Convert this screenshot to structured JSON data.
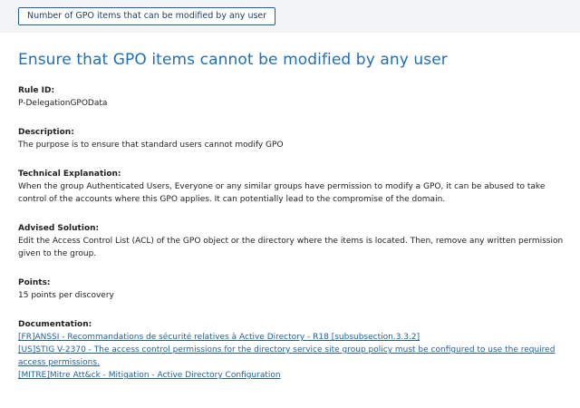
{
  "header": {
    "tag_label": "Number of GPO items that can be modified by any user"
  },
  "page": {
    "title": "Ensure that GPO items cannot be modified by any user"
  },
  "rule_id": {
    "label": "Rule ID:",
    "value": "P-DelegationGPOData"
  },
  "description": {
    "label": "Description:",
    "value": "The purpose is to ensure that standard users cannot modify GPO"
  },
  "technical_explanation": {
    "label": "Technical Explanation:",
    "value": "When the group Authenticated Users, Everyone or any similar groups have permission to modify a GPO, it can be abused to take control of the accounts where this GPO applies. It can potentially lead to the compromise of the domain."
  },
  "advised_solution": {
    "label": "Advised Solution:",
    "value": "Edit the Access Control List (ACL) of the GPO object or the directory where the items is located. Then, remove any written permission given to the group."
  },
  "points": {
    "label": "Points:",
    "value": "15 points per discovery"
  },
  "documentation": {
    "label": "Documentation:",
    "links": [
      "[FR]ANSSI - Recommandations de sécurité relatives à Active Directory - R18 [subsubsection.3.3.2]",
      "[US]STIG V-2370 - The access control permissions for the directory service site group policy must be configured to use the required access permissions.",
      "[MITRE]Mitre Att&ck - Mitigation - Active Directory Configuration"
    ]
  }
}
